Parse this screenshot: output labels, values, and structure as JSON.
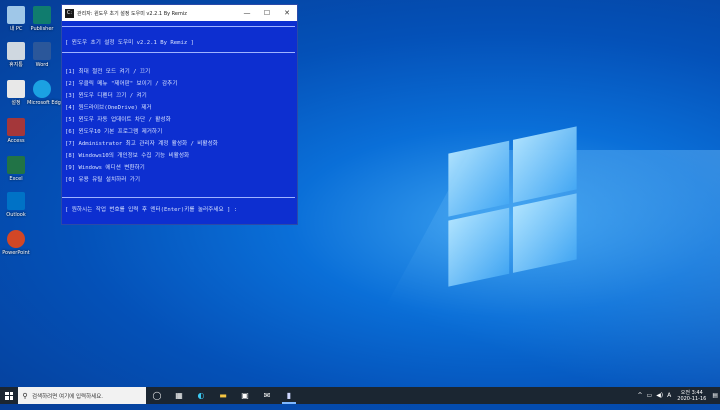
{
  "desktop": {
    "icons": [
      {
        "label": "내 PC",
        "color": "#9fc7e8",
        "icon": "pc-icon"
      },
      {
        "label": "Publisher",
        "color": "#107c6e",
        "icon": "publisher-icon"
      },
      {
        "label": "휴지통",
        "color": "#cfd8e0",
        "icon": "recycle-bin-icon"
      },
      {
        "label": "Word",
        "color": "#2b579a",
        "icon": "word-icon"
      },
      {
        "label": "설정",
        "color": "#e8e8e8",
        "icon": "document-icon"
      },
      {
        "label": "Microsoft Edge",
        "color": "#1ba1e2",
        "icon": "edge-icon"
      },
      {
        "label": "Access",
        "color": "#a4373a",
        "icon": "access-icon"
      },
      {
        "label": "Excel",
        "color": "#217346",
        "icon": "excel-icon"
      },
      {
        "label": "Outlook",
        "color": "#0072c6",
        "icon": "outlook-icon"
      },
      {
        "label": "PowerPoint",
        "color": "#d24726",
        "icon": "powerpoint-icon"
      }
    ]
  },
  "window": {
    "title": "관리자: 윈도우 초기 설정 도우미 v2.2.1 By Remiz",
    "controls": {
      "minimize": "—",
      "maximize": "☐",
      "close": "✕"
    },
    "header": "[ 윈도우 초기 설정 도우미 v2.2.1 By Remiz ]",
    "menu": [
      "[1] 최대 절전 모드 켜기 / 끄기",
      "[2] 우클릭 메뉴 \"제어판\" 보이기 / 감추기",
      "[3] 윈도우 디펜더 끄기 / 켜기",
      "[4] 원드라이브(OneDrive) 제거",
      "[5] 윈도우 자동 업데이트 차단 / 활성화",
      "[6] 윈도우10 기본 프로그램 제거하기",
      "[7] Administrator 최고 관리자 계정 활성화 / 비활성화",
      "[8] Windows10의 개인정보 수집 기능 비활성화",
      "[9] Windows 에디션 변환하기",
      "[0] 유용 유틸 설치하러 가기"
    ],
    "prompt": "[ 원하시는 작업 번호를 입력 후 엔터(Enter)키를 눌러주세요 ] :"
  },
  "taskbar": {
    "search_placeholder": "검색하려면 여기에 입력하세요.",
    "apps": [
      {
        "icon": "task-view-icon",
        "glyph": "◯"
      },
      {
        "icon": "widgets-icon",
        "glyph": "▦"
      },
      {
        "icon": "edge-icon",
        "glyph": "◐"
      },
      {
        "icon": "folder-icon",
        "glyph": "▬"
      },
      {
        "icon": "store-icon",
        "glyph": "▣"
      },
      {
        "icon": "mail-icon",
        "glyph": "✉"
      },
      {
        "icon": "console-icon",
        "glyph": "▮"
      }
    ],
    "tray": {
      "chevron": "^",
      "lang": "A",
      "time": "오전 3:44",
      "date": "2020-11-16"
    }
  }
}
